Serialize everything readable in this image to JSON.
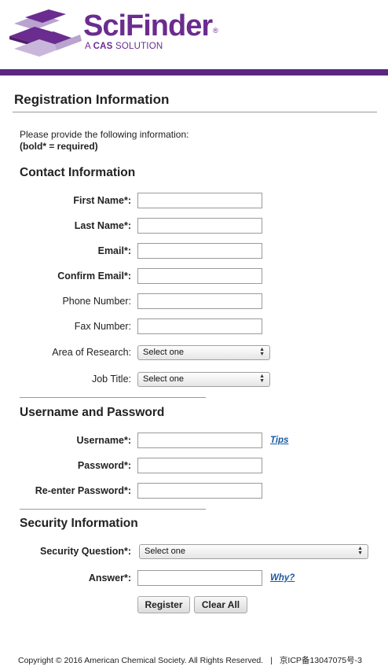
{
  "header": {
    "logo_text": "SciFinder",
    "logo_registered": "®",
    "logo_subtitle_prefix": "A",
    "logo_subtitle_brand": "CAS",
    "logo_subtitle_suffix": "SOLUTION",
    "brand_color": "#6a2c8f",
    "bar_color": "#5b2680"
  },
  "page": {
    "title": "Registration Information",
    "intro_line1": "Please provide the following information:",
    "intro_line2": "(bold* = required)"
  },
  "contact": {
    "heading": "Contact Information",
    "first_name_label": "First Name*:",
    "first_name_value": "",
    "last_name_label": "Last Name*:",
    "last_name_value": "",
    "email_label": "Email*:",
    "email_value": "",
    "confirm_email_label": "Confirm Email*:",
    "confirm_email_value": "",
    "phone_label": "Phone Number:",
    "phone_value": "",
    "fax_label": "Fax Number:",
    "fax_value": "",
    "area_label": "Area of Research:",
    "area_selected": "Select one",
    "job_label": "Job Title:",
    "job_selected": "Select one"
  },
  "credentials": {
    "heading": "Username and Password",
    "username_label": "Username*:",
    "username_value": "",
    "tips_link": "Tips",
    "password_label": "Password*:",
    "password_value": "",
    "reenter_label": "Re-enter Password*:",
    "reenter_value": ""
  },
  "security": {
    "heading": "Security Information",
    "question_label": "Security Question*:",
    "question_selected": "Select one",
    "answer_label": "Answer*:",
    "answer_value": "",
    "why_link": "Why?"
  },
  "actions": {
    "register_label": "Register",
    "clear_label": "Clear All"
  },
  "footer": {
    "copyright": "Copyright © 2016 American Chemical Society. All Rights Reserved.",
    "separator": "|",
    "icp": "京ICP备13047075号-3"
  }
}
